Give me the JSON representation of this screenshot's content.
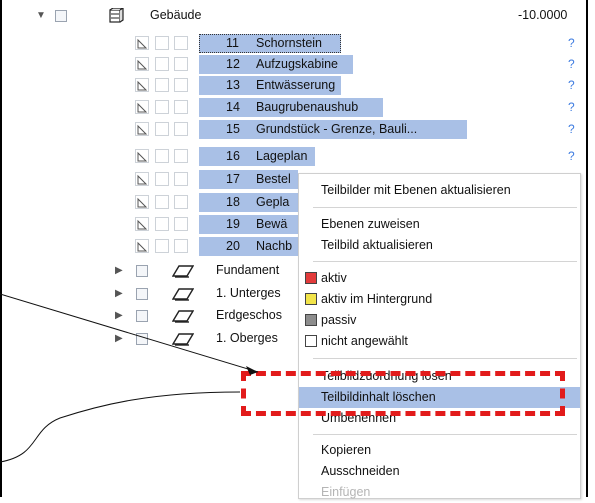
{
  "tree": {
    "root": {
      "label": "Gebäude",
      "value": "-10.0000"
    },
    "children": [
      {
        "num": "11",
        "name": "Schornstein",
        "mark": "?"
      },
      {
        "num": "12",
        "name": "Aufzugskabine",
        "mark": "?"
      },
      {
        "num": "13",
        "name": "Entwässerung",
        "mark": "?"
      },
      {
        "num": "14",
        "name": "Baugrubenaushub",
        "mark": "?"
      },
      {
        "num": "15",
        "name": "Grundstück - Grenze, Bauli...",
        "mark": "?"
      },
      {
        "num": "16",
        "name": "Lageplan",
        "mark": "?"
      },
      {
        "num": "17",
        "name": "Bestel",
        "mark": ""
      },
      {
        "num": "18",
        "name": "Gepla",
        "mark": ""
      },
      {
        "num": "19",
        "name": "Bewä",
        "mark": ""
      },
      {
        "num": "20",
        "name": "Nachb",
        "mark": ""
      }
    ],
    "siblings": [
      {
        "name": "Fundament"
      },
      {
        "name": "1. Unterges"
      },
      {
        "name": "Erdgeschos"
      },
      {
        "name": "1. Oberges"
      }
    ]
  },
  "context_menu": {
    "items": [
      {
        "label": "Teilbilder mit Ebenen aktualisieren"
      },
      {
        "label": "Ebenen zuweisen"
      },
      {
        "label": "Teilbild aktualisieren"
      },
      {
        "label": "aktiv",
        "swatch": "#e23b3b"
      },
      {
        "label": "aktiv im Hintergrund",
        "swatch": "#f2e44a"
      },
      {
        "label": "passiv",
        "swatch": "#8d8d8d"
      },
      {
        "label": "nicht angewählt",
        "swatch": "#ffffff"
      },
      {
        "label": "Teilbildzuordnung lösen"
      },
      {
        "label": "Teilbildinhalt löschen"
      },
      {
        "label": "Umbenennen"
      },
      {
        "label": "Kopieren"
      },
      {
        "label": "Ausschneiden"
      },
      {
        "label": "Einfügen"
      }
    ]
  },
  "colors": {
    "selection": "#a9c0e6",
    "highlight_box": "#e21b1b",
    "question_mark": "#3d7be0"
  }
}
